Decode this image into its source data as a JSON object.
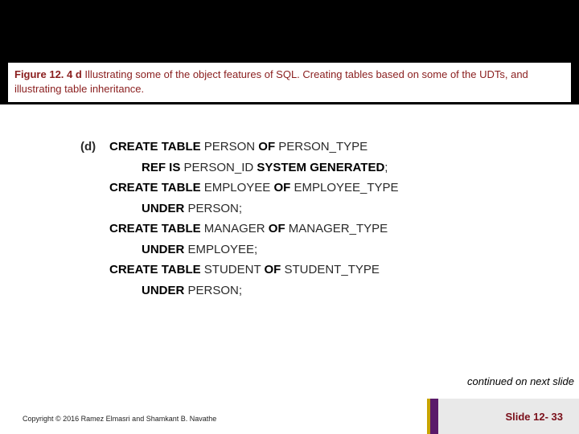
{
  "caption": {
    "label": "Figure 12. 4 d",
    "text": "   Illustrating some of the object features of SQL. Creating tables based on some of the UDTs, and illustrating table inheritance."
  },
  "code": {
    "marker": "(d)",
    "lines": [
      {
        "indent": 0,
        "segments": [
          {
            "t": "CREATE TABLE ",
            "kw": true
          },
          {
            "t": "PERSON ",
            "kw": false
          },
          {
            "t": "OF ",
            "kw": true
          },
          {
            "t": "PERSON_TYPE",
            "kw": false
          }
        ]
      },
      {
        "indent": 1,
        "segments": [
          {
            "t": "REF IS ",
            "kw": true
          },
          {
            "t": "PERSON_ID ",
            "kw": false
          },
          {
            "t": "SYSTEM GENERATED",
            "kw": true
          },
          {
            "t": ";",
            "kw": false
          }
        ]
      },
      {
        "indent": 0,
        "segments": [
          {
            "t": "CREATE TABLE ",
            "kw": true
          },
          {
            "t": "EMPLOYEE ",
            "kw": false
          },
          {
            "t": "OF ",
            "kw": true
          },
          {
            "t": "EMPLOYEE_TYPE",
            "kw": false
          }
        ]
      },
      {
        "indent": 1,
        "segments": [
          {
            "t": "UNDER ",
            "kw": true
          },
          {
            "t": "PERSON;",
            "kw": false
          }
        ]
      },
      {
        "indent": 0,
        "segments": [
          {
            "t": "CREATE TABLE ",
            "kw": true
          },
          {
            "t": "MANAGER ",
            "kw": false
          },
          {
            "t": "OF ",
            "kw": true
          },
          {
            "t": "MANAGER_TYPE",
            "kw": false
          }
        ]
      },
      {
        "indent": 1,
        "segments": [
          {
            "t": "UNDER ",
            "kw": true
          },
          {
            "t": "EMPLOYEE;",
            "kw": false
          }
        ]
      },
      {
        "indent": 0,
        "segments": [
          {
            "t": "CREATE TABLE ",
            "kw": true
          },
          {
            "t": "STUDENT ",
            "kw": false
          },
          {
            "t": "OF ",
            "kw": true
          },
          {
            "t": "STUDENT_TYPE",
            "kw": false
          }
        ]
      },
      {
        "indent": 1,
        "segments": [
          {
            "t": "UNDER ",
            "kw": true
          },
          {
            "t": "PERSON;",
            "kw": false
          }
        ]
      }
    ]
  },
  "footer": {
    "continued": "continued on next slide",
    "copyright": "Copyright © 2016 Ramez Elmasri and Shamkant B. Navathe",
    "slide": "Slide 12- 33"
  }
}
